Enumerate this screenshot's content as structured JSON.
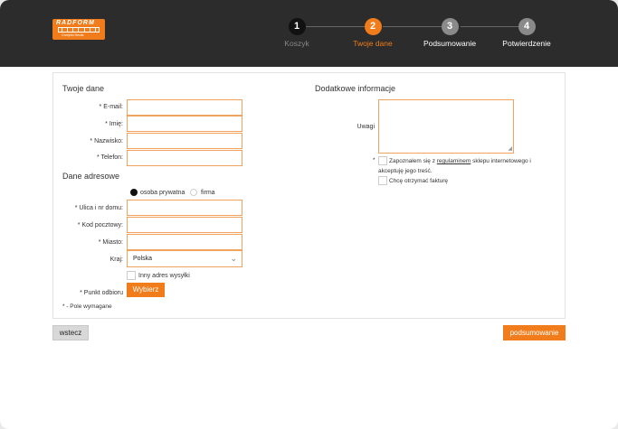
{
  "logo": {
    "brand": "RADFORM",
    "tagline": "Grzejniki Hestia"
  },
  "steps": [
    {
      "num": "1",
      "label": "Koszyk",
      "state": "done"
    },
    {
      "num": "2",
      "label": "Twoje dane",
      "state": "active"
    },
    {
      "num": "3",
      "label": "Podsumowanie",
      "state": "todo"
    },
    {
      "num": "4",
      "label": "Potwierdzenie",
      "state": "todo"
    }
  ],
  "left": {
    "section1": "Twoje dane",
    "email_label": "* E-mail:",
    "first_name_label": "* Imię:",
    "last_name_label": "* Nazwisko:",
    "phone_label": "* Telefon:",
    "section2": "Dane adresowe",
    "radio_private": "osoba prywatna",
    "radio_company": "firma",
    "street_label": "* Ulica i nr domu:",
    "zip_label": "* Kod pocztowy:",
    "city_label": "* Miasto:",
    "country_label": "Kraj:",
    "country_value": "Polska",
    "other_shipping": "Inny adres wysyłki",
    "pickup_label": "* Punkt odbioru",
    "pickup_button": "Wybierz",
    "required_note": "* - Pole wymagane"
  },
  "right": {
    "section": "Dodatkowe informacje",
    "notes_label": "Uwagi",
    "terms_star": "*",
    "terms_text_1": "Zapoznałem się z ",
    "terms_link": "regulaminem",
    "terms_text_2": " sklepu internetowego i",
    "terms_text_3": "akceptuję jego treść.",
    "invoice_label": "Chcę otrzymać fakturę"
  },
  "footer": {
    "back": "wstecz",
    "next": "podsumowanie"
  },
  "colors": {
    "accent": "#f07c1b",
    "header_bg": "#2c2c2c"
  }
}
